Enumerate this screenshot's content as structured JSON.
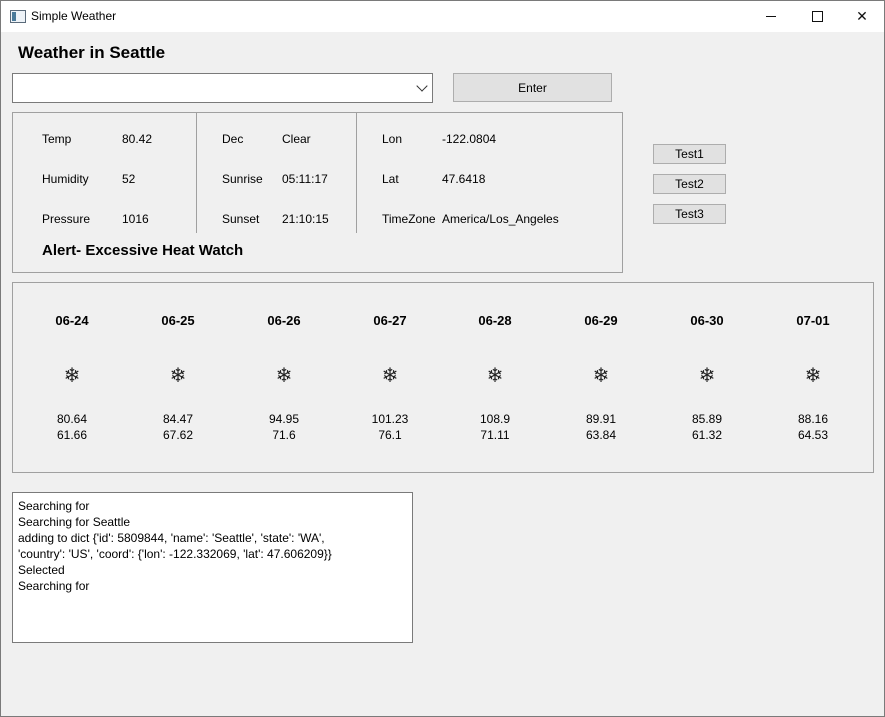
{
  "window": {
    "title": "Simple Weather",
    "app_icon": "window-app-icon",
    "controls": {
      "minimize": "minimize-icon",
      "maximize": "maximize-icon",
      "close": "close-icon",
      "close_glyph": "✕"
    }
  },
  "heading": "Weather in Seattle",
  "city_select": {
    "value": "",
    "arrow_icon": "chevron-down-icon"
  },
  "enter_label": "Enter",
  "current": {
    "col1": [
      {
        "label": "Temp",
        "value": "80.42"
      },
      {
        "label": "Humidity",
        "value": "52"
      },
      {
        "label": "Pressure",
        "value": "1016"
      }
    ],
    "col2": [
      {
        "label": "Dec",
        "value": "Clear"
      },
      {
        "label": "Sunrise",
        "value": "05:11:17"
      },
      {
        "label": "Sunset",
        "value": "21:10:15"
      }
    ],
    "col3": [
      {
        "label": "Lon",
        "value": "-122.0804"
      },
      {
        "label": "Lat",
        "value": "47.6418"
      },
      {
        "label": "TimeZone",
        "value": "America/Los_Angeles"
      }
    ],
    "alert": "Alert- Excessive Heat Watch"
  },
  "tests": [
    "Test1",
    "Test2",
    "Test3"
  ],
  "forecast": [
    {
      "date": "06-24",
      "icon": "❄",
      "icon_name": "snowflake-icon",
      "high": "80.64",
      "low": "61.66"
    },
    {
      "date": "06-25",
      "icon": "❄",
      "icon_name": "snowflake-icon",
      "high": "84.47",
      "low": "67.62"
    },
    {
      "date": "06-26",
      "icon": "❄",
      "icon_name": "snowflake-icon",
      "high": "94.95",
      "low": "71.6"
    },
    {
      "date": "06-27",
      "icon": "❄",
      "icon_name": "snowflake-icon",
      "high": "101.23",
      "low": "76.1"
    },
    {
      "date": "06-28",
      "icon": "❄",
      "icon_name": "snowflake-icon",
      "high": "108.9",
      "low": "71.11"
    },
    {
      "date": "06-29",
      "icon": "❄",
      "icon_name": "snowflake-icon",
      "high": "89.91",
      "low": "63.84"
    },
    {
      "date": "06-30",
      "icon": "❄",
      "icon_name": "snowflake-icon",
      "high": "85.89",
      "low": "61.32"
    },
    {
      "date": "07-01",
      "icon": "❄",
      "icon_name": "snowflake-icon",
      "high": "88.16",
      "low": "64.53"
    }
  ],
  "log": [
    "Searching for",
    "Searching for Seattle",
    "adding to dict {'id': 5809844, 'name': 'Seattle', 'state': 'WA',",
    "'country': 'US', 'coord': {'lon': -122.332069, 'lat': 47.606209}}",
    "Selected",
    "Searching for"
  ]
}
